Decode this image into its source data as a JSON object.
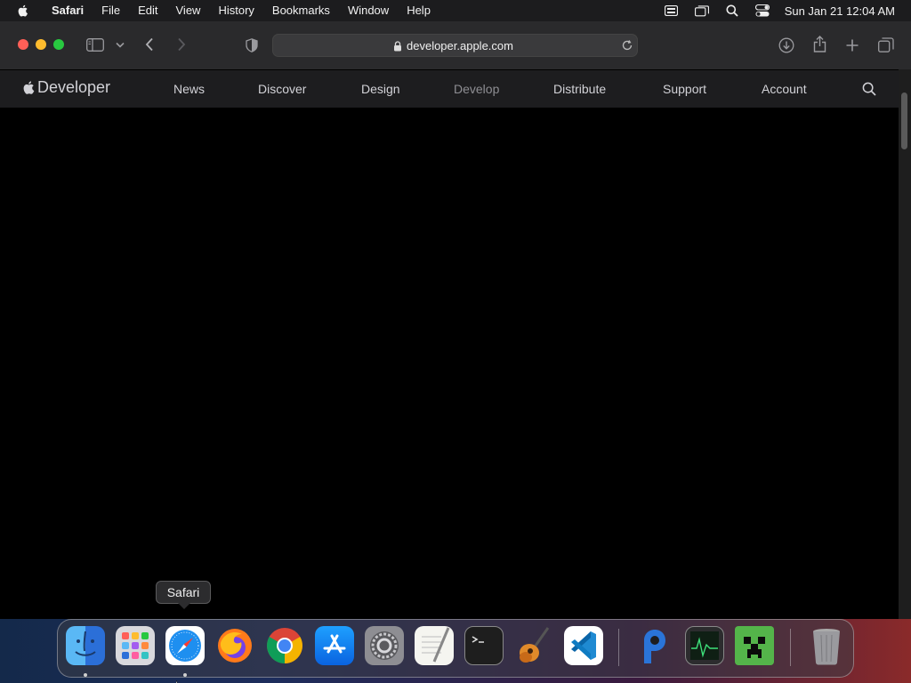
{
  "menubar": {
    "app_name": "Safari",
    "items": [
      "File",
      "Edit",
      "View",
      "History",
      "Bookmarks",
      "Window",
      "Help"
    ],
    "clock": "Sun Jan 21  12:04 AM",
    "status_icons": [
      "keyboard-input-icon",
      "screen-mirroring-icon",
      "spotlight-search-icon",
      "control-center-icon"
    ]
  },
  "toolbar": {
    "url": "developer.apple.com",
    "icons": [
      "sidebar-icon",
      "chevron-down-icon",
      "back-icon",
      "forward-icon",
      "privacy-shield-icon",
      "lock-icon",
      "reload-icon",
      "downloads-icon",
      "share-icon",
      "new-tab-icon",
      "tab-overview-icon"
    ]
  },
  "devnav": {
    "logo_text": "Developer",
    "links": [
      "News",
      "Discover",
      "Design",
      "Develop",
      "Distribute",
      "Support",
      "Account"
    ],
    "active": "Develop"
  },
  "tooltip": {
    "text": "Safari"
  },
  "dock": {
    "apps": [
      "Finder",
      "Launchpad",
      "Safari",
      "Firefox",
      "Google Chrome",
      "App Store",
      "System Settings",
      "TextEdit",
      "Terminal",
      "GarageBand",
      "Visual Studio Code",
      "PyCharm",
      "Activity Monitor",
      "Minecraft",
      "Trash"
    ],
    "running": [
      "Finder",
      "Safari"
    ]
  },
  "colors": {
    "menubar_bg": "#1c1c1e",
    "toolbar_bg": "#2a2a2c",
    "nav_bg": "#1d1d1f",
    "content_bg": "#000000",
    "close": "#ff5f57",
    "minimize": "#febc2e",
    "maximize": "#28c840"
  }
}
